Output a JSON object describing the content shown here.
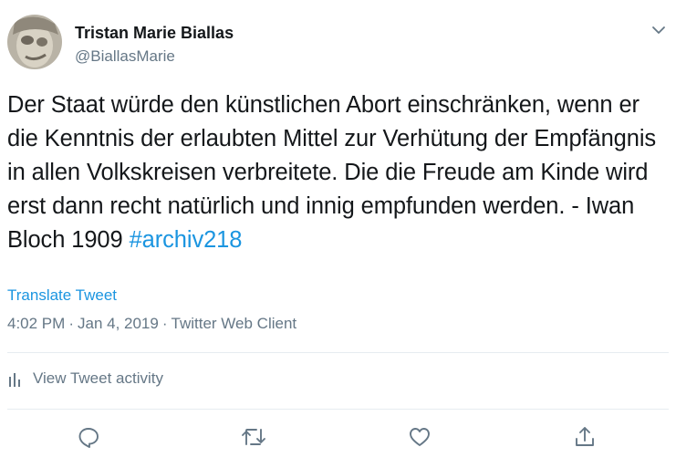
{
  "author": {
    "name": "Tristan Marie Biallas",
    "handle": "@BiallasMarie"
  },
  "tweet": {
    "text": "Der Staat würde den künstlichen Abort einschränken, wenn er die Kenntnis der erlaubten Mittel zur Verhütung der Empfängnis in allen Volkskreisen verbreitete. Die die Freude am Kinde wird erst dann recht natürlich und innig empfunden werden. -  Iwan Bloch 1909 ",
    "hashtag": "#archiv218",
    "translate_label": "Translate Tweet",
    "time": "4:02 PM",
    "date": "Jan 4, 2019",
    "client": "Twitter Web Client",
    "separator": "·"
  },
  "activity": {
    "label": "View Tweet activity",
    "icon": "bar-chart-icon"
  },
  "actions": [
    {
      "name": "reply",
      "icon": "reply-icon"
    },
    {
      "name": "retweet",
      "icon": "retweet-icon"
    },
    {
      "name": "like",
      "icon": "heart-icon"
    },
    {
      "name": "share",
      "icon": "share-icon"
    }
  ],
  "colors": {
    "link": "#1b95e0",
    "secondary": "#657786",
    "text": "#14171a",
    "divider": "#e6ecf0"
  }
}
